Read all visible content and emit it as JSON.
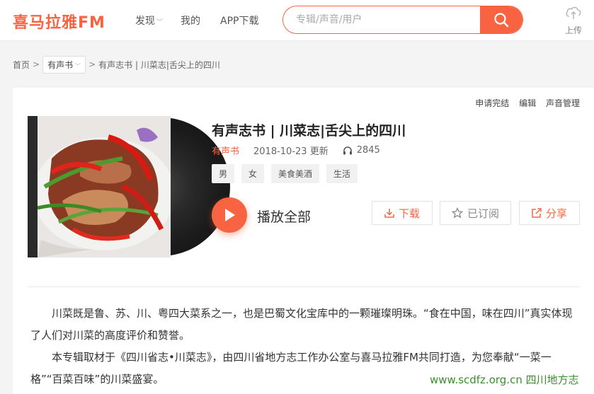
{
  "header": {
    "logo": "喜马拉雅FM",
    "nav": {
      "discover": "发现",
      "mine": "我的",
      "app": "APP下载"
    },
    "search_placeholder": "专辑/声音/用户",
    "upload_label": "上传"
  },
  "breadcrumb": {
    "home": "首页",
    "sep": ">",
    "category": "有声书",
    "current": "有声志书 | 川菜志|舌尖上的四川"
  },
  "album": {
    "top_links": [
      "申请完结",
      "编辑",
      "声音管理"
    ],
    "title": "有声志书 | 川菜志|舌尖上的四川",
    "category": "有声书",
    "date": "2018-10-23 更新",
    "plays": "2845",
    "tags": [
      "男",
      "女",
      "美食美酒",
      "生活"
    ],
    "play_all": "播放全部",
    "actions": {
      "download": "下载",
      "subscribe": "已订阅",
      "share": "分享"
    },
    "intro": [
      "川菜既是鲁、苏、川、粤四大菜系之一，也是巴蜀文化宝库中的一颗璀璨明珠。“食在中国，味在四川”真实体现了人们对川菜的高度评价和赞誉。",
      "本专辑取材于《四川省志•川菜志》，由四川省地方志工作办公室与喜马拉雅FM共同打造，为您奉献“一菜一格”“百菜百味”的川菜盛宴。"
    ]
  },
  "watermark": "www.scdfz.org.cn   四川地方志",
  "colors": {
    "accent": "#f86442",
    "watermark": "#3a8f2c"
  }
}
